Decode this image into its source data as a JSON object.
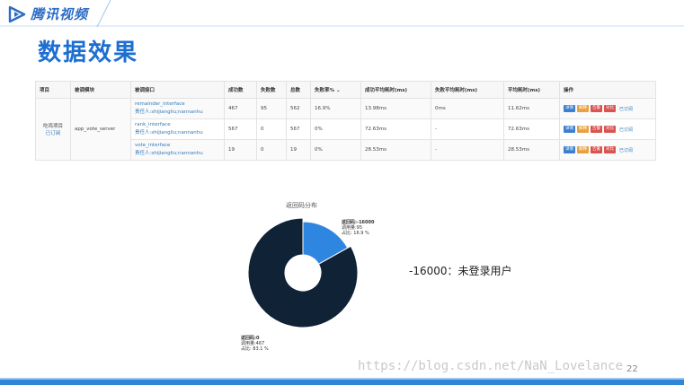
{
  "brand": {
    "name": "腾讯视频",
    "accent": "#2b6cc4"
  },
  "title": "数据效果",
  "table": {
    "headers": [
      "项目",
      "被调模块",
      "被调接口",
      "成功数",
      "失败数",
      "总数",
      "失败率%",
      "成功平均耗时(ms)",
      "失败平均耗时(ms)",
      "平均耗时(ms)",
      "操作"
    ],
    "project": {
      "name": "吃鸡项目",
      "subscribed": "已订阅"
    },
    "module": "app_vote_server",
    "rows": [
      {
        "interface": "remainder_interface",
        "owner": "责任人:shijiangliu;nannanhu",
        "success": "467",
        "fail": "95",
        "total": "562",
        "fail_rate": "16.9%",
        "succ_avg": "13.98ms",
        "fail_avg": "0ms",
        "avg": "11.62ms"
      },
      {
        "interface": "rank_interface",
        "owner": "责任人:shijiangliu;nannanhu",
        "success": "567",
        "fail": "0",
        "total": "567",
        "fail_rate": "0%",
        "succ_avg": "72.63ms",
        "fail_avg": "-",
        "avg": "72.63ms"
      },
      {
        "interface": "vote_interface",
        "owner": "责任人:shijiangliu;nannanhu",
        "success": "19",
        "fail": "0",
        "total": "19",
        "fail_rate": "0%",
        "succ_avg": "28.53ms",
        "fail_avg": "-",
        "avg": "28.53ms"
      }
    ],
    "ops": {
      "detail": "详情",
      "explain": "解释",
      "alarm": "告警",
      "compare": "对比",
      "subscribed": "已订阅"
    }
  },
  "chart_data": {
    "type": "pie",
    "title": "返回码分布",
    "labels": [
      "返回码:-16000",
      "返回码:0"
    ],
    "values": [
      95,
      467
    ],
    "percent": [
      16.9,
      83.1
    ],
    "colors": [
      "#2f86e0",
      "#0f2236"
    ],
    "annotations": [
      {
        "code": "返回码:-16000",
        "count": "调用量:95",
        "ratio": "占比: 16.9 %"
      },
      {
        "code": "返回码:0",
        "count": "调用量:467",
        "ratio": "占比: 83.1 %"
      }
    ]
  },
  "annotation_text": "-16000：未登录用户",
  "watermark": "https://blog.csdn.net/NaN_Lovelance",
  "page_number": "22"
}
